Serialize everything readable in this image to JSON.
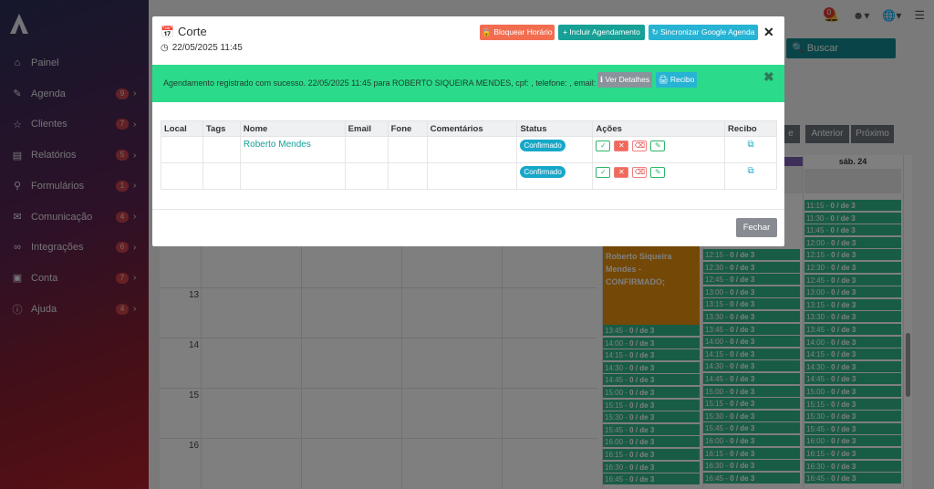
{
  "sidebar": {
    "items": [
      {
        "label": "Painel",
        "icon": "home-icon",
        "badge": ""
      },
      {
        "label": "Agenda",
        "icon": "edit-icon",
        "badge": "9"
      },
      {
        "label": "Clientes",
        "icon": "star-icon",
        "badge": "7"
      },
      {
        "label": "Relatórios",
        "icon": "book-icon",
        "badge": "5"
      },
      {
        "label": "Formulários",
        "icon": "search-icon",
        "badge": "1"
      },
      {
        "label": "Comunicação",
        "icon": "mail-icon",
        "badge": "4"
      },
      {
        "label": "Integrações",
        "icon": "link-icon",
        "badge": "6"
      },
      {
        "label": "Conta",
        "icon": "briefcase-icon",
        "badge": "7"
      },
      {
        "label": "Ajuda",
        "icon": "help-icon",
        "badge": "4"
      }
    ]
  },
  "topbar": {
    "notification_count": "0"
  },
  "background": {
    "search_label": "Buscar",
    "prev_label": "Anterior",
    "next_label": "Próximo",
    "day_header": "sáb. 24",
    "hours": [
      "13",
      "14",
      "15",
      "16"
    ],
    "booked_text": "Roberto Siqueira Mendes - CONFIRMADO;",
    "slot_suffix": "0 / de 3",
    "col_left_slots": [
      "13:45 -",
      "14:00 -",
      "14:15 -",
      "14:30 -",
      "14:45 -",
      "15:00 -",
      "15:15 -",
      "15:30 -",
      "15:45 -",
      "16:00 -",
      "16:15 -",
      "16:30 -",
      "16:45 -"
    ],
    "col_mid_slots": [
      "12:15 -",
      "12:30 -",
      "12:45 -",
      "13:00 -",
      "13:15 -",
      "13:30 -",
      "13:45 -",
      "14:00 -",
      "14:15 -",
      "14:30 -",
      "14:45 -",
      "15:00 -",
      "15:15 -",
      "15:30 -",
      "15:45 -",
      "16:00 -",
      "16:15 -",
      "16:30 -",
      "16:45 -"
    ],
    "col_right_slots": [
      "11:15 -",
      "11:30 -",
      "11:45 -",
      "12:00 -",
      "12:15 -",
      "12:30 -",
      "12:45 -",
      "13:00 -",
      "13:15 -",
      "13:30 -",
      "13:45 -",
      "14:00 -",
      "14:15 -",
      "14:30 -",
      "14:45 -",
      "15:00 -",
      "15:15 -",
      "15:30 -",
      "15:45 -",
      "16:00 -",
      "16:15 -",
      "16:30 -",
      "16:45 -"
    ]
  },
  "modal": {
    "title": "Corte",
    "datetime": "22/05/2025 11:45",
    "btn_block": "Bloquear Horário",
    "btn_add": "+ Incluir Agendamento",
    "btn_sync": "Sincronizar Google Agenda",
    "alert": {
      "text": "Agendamento registrado com sucesso. 22/05/2025 11:45 para ROBERTO SIQUEIRA MENDES, cpf: , telefone: , email:",
      "details_label": "Ver Detalhes",
      "receipt_label": "Recibo"
    },
    "table": {
      "headers": [
        "Local",
        "Tags",
        "Nome",
        "Email",
        "Fone",
        "Comentários",
        "Status",
        "Ações",
        "Recibo"
      ],
      "rows": [
        {
          "local": "",
          "tags": "",
          "nome": "Roberto Mendes",
          "email": "",
          "fone": "",
          "comentarios": "",
          "status": "Confirmado"
        },
        {
          "local": "",
          "tags": "",
          "nome": "",
          "email": "",
          "fone": "",
          "comentarios": "",
          "status": "Confirmado"
        }
      ]
    },
    "close_label": "Fechar"
  }
}
